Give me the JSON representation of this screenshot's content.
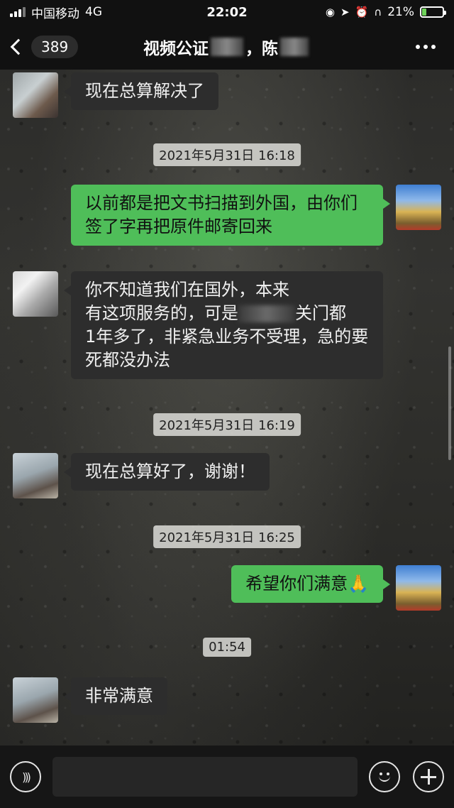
{
  "status_bar": {
    "carrier": "中国移动",
    "network": "4G",
    "time": "22:02",
    "battery_text": "21%",
    "battery_level_percent": 21,
    "icons": [
      "signal-icon",
      "location-icon",
      "alarm-icon",
      "headphones-icon",
      "battery-icon"
    ]
  },
  "nav": {
    "back_count": "389",
    "title_part1": "视频公证",
    "title_part2": "，陈",
    "more_icon": "more-icon"
  },
  "messages": [
    {
      "side": "in",
      "text": "现在总算解决了"
    },
    {
      "type": "timestamp",
      "text": "2021年5月31日 16:18"
    },
    {
      "side": "out",
      "text": "以前都是把文书扫描到外国，由你们签了字再把原件邮寄回来"
    },
    {
      "side": "in",
      "line1": "你不知道我们在国外，本来",
      "line2a": "有这项服务的，可是",
      "line2b": "关门都",
      "line3": "1年多了，非紧急业务不受理，急的要死都没办法"
    },
    {
      "type": "timestamp",
      "text": "2021年5月31日 16:19"
    },
    {
      "side": "in",
      "text": "现在总算好了，谢谢！"
    },
    {
      "type": "timestamp",
      "text": "2021年5月31日 16:25"
    },
    {
      "side": "out",
      "text": "希望你们满意",
      "emoji": "🙏"
    },
    {
      "type": "timestamp",
      "text": "01:54"
    },
    {
      "side": "in",
      "text": "非常满意"
    }
  ],
  "input_bar": {
    "voice_icon": "voice-icon",
    "input_value": "",
    "emoji_icon": "emoji-icon",
    "plus_icon": "plus-icon"
  },
  "colors": {
    "outgoing_bubble": "#4fbe59",
    "incoming_bubble": "#2d2d2d",
    "bar_background": "#111111"
  }
}
